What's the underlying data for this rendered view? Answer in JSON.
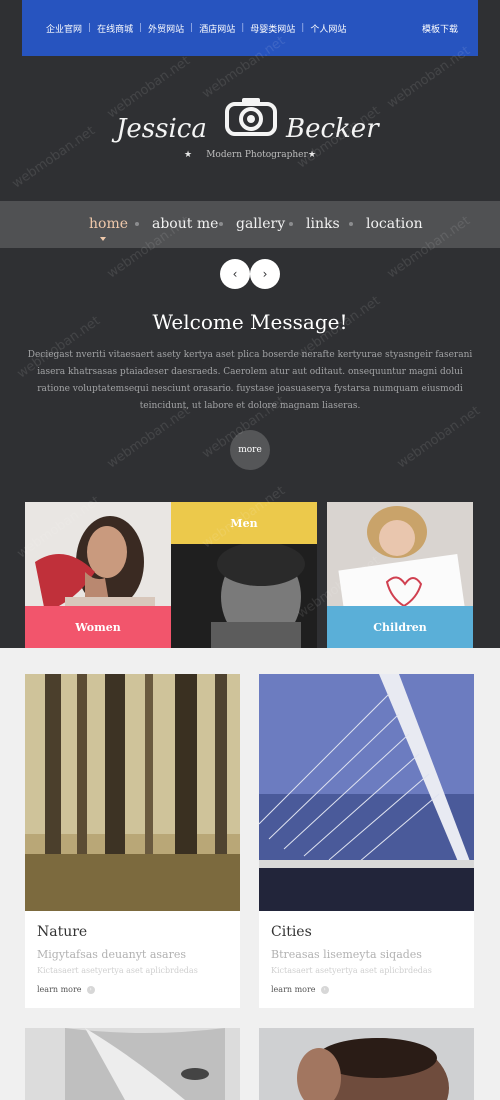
{
  "topbar": {
    "items": [
      "企业官网",
      "在线商城",
      "外贸网站",
      "酒店网站",
      "母婴类网站",
      "个人网站"
    ],
    "download": "模板下载"
  },
  "logo": {
    "name_first": "Jessica",
    "name_last": "Becker",
    "subtitle": "Modern Photographer"
  },
  "nav": {
    "items": [
      "home",
      "about me",
      "gallery",
      "links",
      "location"
    ],
    "active": "home"
  },
  "welcome": {
    "title": "Welcome Message!",
    "text": "Deciegast nveriti vitaesaert asety kertya aset plica boserde nerafte kertyurae styasngeir faserani iasera khatrsasas ptaiadeser daesraeds. Caerolem atur aut oditaut. onsequuntur magni dolui ratione voluptatemsequi nesciunt orasario. fuystase joasuaserya fystarsa numquam eiusmodi teincidunt, ut labore et dolore magnam liaseras.",
    "more": "more"
  },
  "tiles": [
    {
      "label": "Women",
      "color": "#f2556c"
    },
    {
      "label": "Men",
      "color": "#ecc94b"
    },
    {
      "label": "Children",
      "color": "#5aafd8"
    }
  ],
  "cards": [
    {
      "title": "Nature",
      "subtitle": "Migytafsas deuanyt asares",
      "desc": "Kictasaert asetyertya aset aplicbrdedas",
      "link": "learn more"
    },
    {
      "title": "Cities",
      "subtitle": "Btreasas lisemeyta siqades",
      "desc": "Kictasaert asetyertya aset aplicbrdedas",
      "link": "learn more"
    }
  ],
  "watermark": "webmoban.net",
  "colors": {
    "topbar": "#2754bf",
    "dark_bg": "#2f3033",
    "nav_active": "#f0c9ab"
  }
}
